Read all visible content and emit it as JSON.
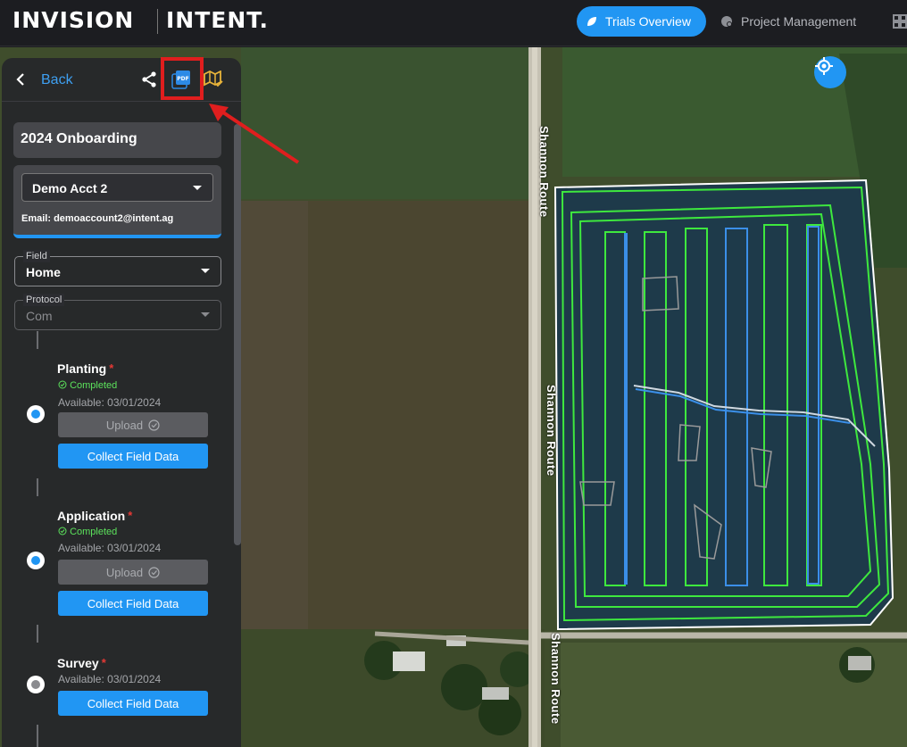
{
  "header": {
    "brand_left": "INVISION",
    "brand_right": "INTENT.",
    "nav_active": "Trials Overview",
    "nav_item": "Project Management"
  },
  "map": {
    "road_name_1": "Shannon Route",
    "road_name_2": "Shannon Route",
    "road_name_3": "Shannon Route"
  },
  "panel": {
    "back_label": "Back",
    "trial_name": "2024 Onboarding",
    "account": {
      "selected": "Demo Acct 2",
      "email": "Email: demoaccount2@intent.ag"
    },
    "field": {
      "legend": "Field",
      "value": "Home"
    },
    "protocol": {
      "legend": "Protocol",
      "value": "Com"
    },
    "steps": [
      {
        "title": "Planting",
        "required": "*",
        "status": "Completed",
        "available": "Available: 03/01/2024",
        "upload": "Upload",
        "collect": "Collect Field Data"
      },
      {
        "title": "Application",
        "required": "*",
        "status": "Completed",
        "available": "Available: 03/01/2024",
        "upload": "Upload",
        "collect": "Collect Field Data"
      },
      {
        "title": "Survey",
        "required": "*",
        "available": "Available: 03/01/2024",
        "collect": "Collect Field Data"
      }
    ]
  },
  "colors": {
    "accent": "#2196f3",
    "completed": "#5ce35c",
    "highlight": "#e01e1e",
    "trial_lines_green": "#3ee83e",
    "trial_lines_blue": "#3b8fe8"
  }
}
